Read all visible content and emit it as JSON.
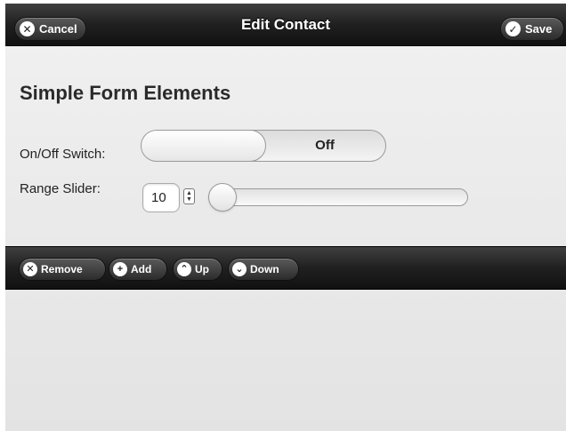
{
  "header": {
    "title": "Edit Contact",
    "cancel_label": "Cancel",
    "save_label": "Save"
  },
  "form": {
    "heading": "Simple Form Elements",
    "switch_label": "On/Off Switch:",
    "switch_state": "Off",
    "range_label": "Range Slider:",
    "range_value": "10"
  },
  "footer": {
    "remove_label": "Remove",
    "add_label": "Add",
    "up_label": "Up",
    "down_label": "Down"
  },
  "icons": {
    "cancel": "close-icon",
    "save": "checkmark-icon",
    "remove": "close-icon",
    "add": "plus-icon",
    "up": "chevron-up-icon",
    "down": "chevron-down-icon"
  }
}
